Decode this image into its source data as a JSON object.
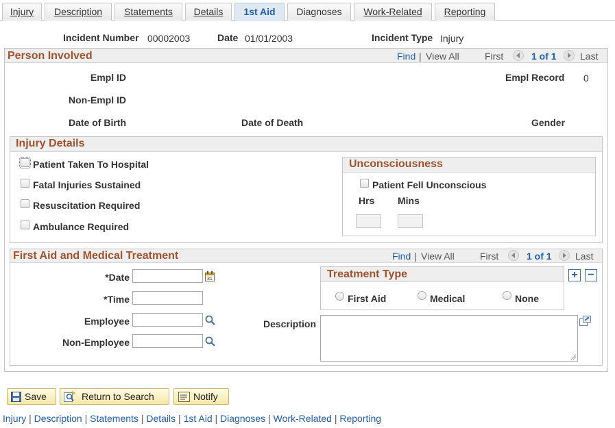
{
  "tabs": [
    {
      "label": "Injury",
      "active": false
    },
    {
      "label": "Description",
      "active": false
    },
    {
      "label": "Statements",
      "active": false
    },
    {
      "label": "Details",
      "active": false
    },
    {
      "label": "1st Aid",
      "active": true
    },
    {
      "label": "Diagnoses",
      "active": false
    },
    {
      "label": "Work-Related",
      "active": false
    },
    {
      "label": "Reporting",
      "active": false
    }
  ],
  "header": {
    "incident_number_label": "Incident Number",
    "incident_number": "00002003",
    "date_label": "Date",
    "date": "01/01/2003",
    "incident_type_label": "Incident Type",
    "incident_type": "Injury"
  },
  "person": {
    "title": "Person Involved",
    "nav": {
      "find": "Find",
      "view_all": "View All",
      "first": "First",
      "count": "1 of 1",
      "last": "Last"
    },
    "empl_id_label": "Empl ID",
    "empl_record_label": "Empl Record",
    "empl_record": "0",
    "non_empl_id_label": "Non-Empl ID",
    "dob_label": "Date of Birth",
    "dod_label": "Date of Death",
    "gender_label": "Gender"
  },
  "injury": {
    "title": "Injury Details",
    "checks": {
      "hospital": "Patient Taken To Hospital",
      "fatal": "Fatal Injuries Sustained",
      "resus": "Resuscitation Required",
      "ambulance": "Ambulance Required"
    },
    "uncon": {
      "title": "Unconsciousness",
      "fell": "Patient Fell Unconscious",
      "hrs": "Hrs",
      "mins": "Mins"
    }
  },
  "first_aid": {
    "title": "First Aid and Medical Treatment",
    "nav": {
      "find": "Find",
      "view_all": "View All",
      "first": "First",
      "count": "1 of 1",
      "last": "Last"
    },
    "date_label": "*Date",
    "time_label": "*Time",
    "employee_label": "Employee",
    "non_employee_label": "Non-Employee",
    "description_label": "Description",
    "treatment": {
      "title": "Treatment Type",
      "first_aid": "First Aid",
      "medical": "Medical",
      "none": "None"
    },
    "add": "+",
    "remove": "−"
  },
  "buttons": {
    "save": "Save",
    "return": "Return to Search",
    "notify": "Notify"
  },
  "links": [
    "Injury",
    "Description",
    "Statements",
    "Details",
    "1st Aid",
    "Diagnoses",
    "Work-Related",
    "Reporting"
  ],
  "link_sep": "|",
  "colors": {
    "title": "#a0522d",
    "link": "#1f5ea8",
    "active_tab": "#dfe9f3"
  }
}
